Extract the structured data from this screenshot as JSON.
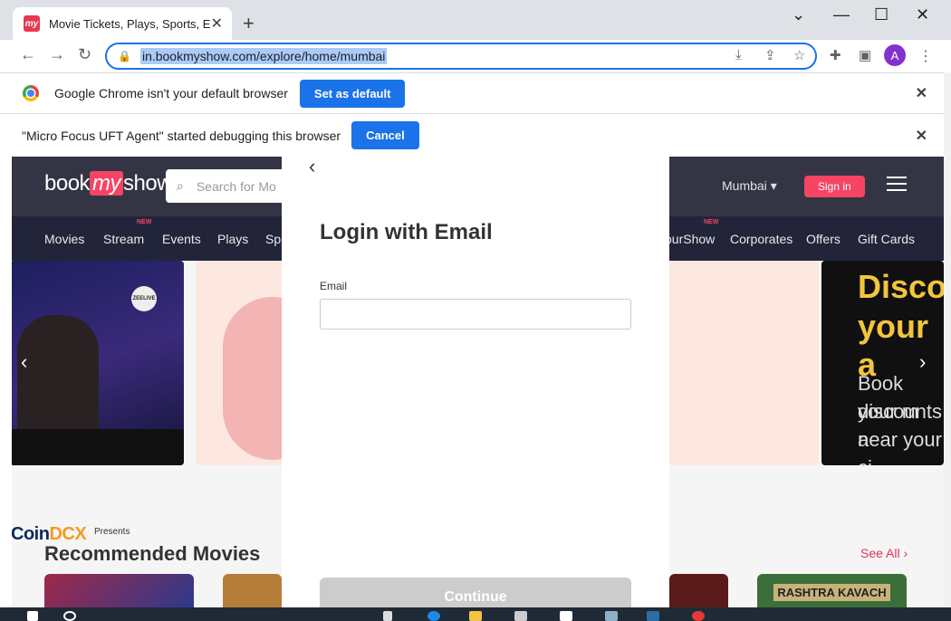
{
  "browser": {
    "tab_title": "Movie Tickets, Plays, Sports, Even",
    "url": "in.bookmyshow.com/explore/home/mumbai",
    "profile_initial": "A"
  },
  "infobars": {
    "default_browser_msg": "Google Chrome isn't your default browser",
    "set_default_label": "Set as default",
    "debug_msg": "\"Micro Focus UFT Agent\" started debugging this browser",
    "cancel_label": "Cancel"
  },
  "site": {
    "logo_book": "book",
    "logo_my": "my",
    "logo_show": "show",
    "search_placeholder": "Search for Mo",
    "city": "Mumbai",
    "signin_label": "Sign in",
    "nav": [
      "Movies",
      "Stream",
      "Events",
      "Plays",
      "Sp",
      "ourShow",
      "Corporates",
      "Offers",
      "Gift Cards"
    ],
    "new_tag": "NEW",
    "banner_right_text": [
      "Discou",
      "your a",
      "Book your m",
      "discounts a",
      "near your ci"
    ],
    "banner_left_badge": "ZEELIVE",
    "sponsor": "Coin",
    "sponsor_dx": "DCX",
    "presents": "Presents",
    "rec_title": "Recommended Movies",
    "see_all": "See All ›",
    "poster_text": "RASHTRA KAVACH"
  },
  "modal": {
    "title": "Login with Email",
    "email_label": "Email",
    "email_value": "",
    "continue_label": "Continue"
  }
}
